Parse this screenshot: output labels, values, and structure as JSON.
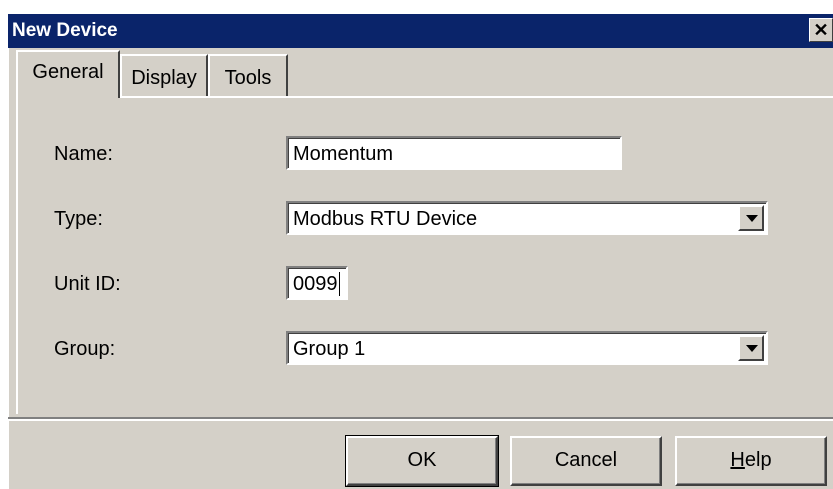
{
  "window": {
    "title": "New Device",
    "close_glyph": "✕"
  },
  "tabs": [
    {
      "label": "General",
      "active": true
    },
    {
      "label": "Display",
      "active": false
    },
    {
      "label": "Tools",
      "active": false
    }
  ],
  "form": {
    "name": {
      "label": "Name:",
      "value": "Momentum"
    },
    "type": {
      "label": "Type:",
      "value": "Modbus RTU Device"
    },
    "unit_id": {
      "label": "Unit ID:",
      "value": "0099"
    },
    "group": {
      "label": "Group:",
      "value": "Group 1"
    }
  },
  "buttons": {
    "ok": "OK",
    "cancel": "Cancel",
    "help": "Help"
  },
  "colors": {
    "titlebar": "#0a246a",
    "face": "#d4d0c8"
  }
}
